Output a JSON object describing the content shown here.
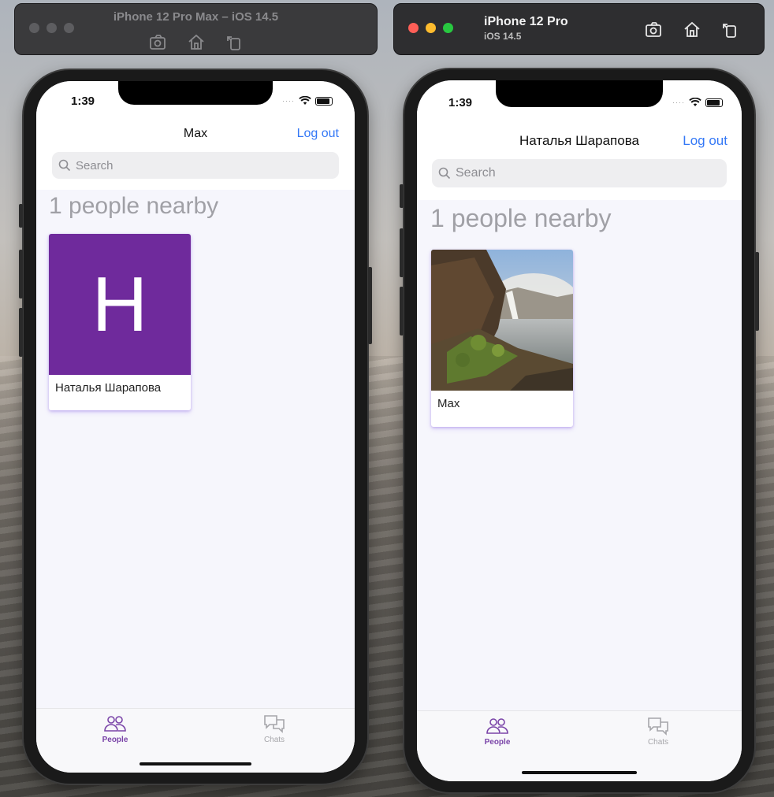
{
  "left_window": {
    "title": "iPhone 12 Pro Max – iOS 14.5",
    "icons": [
      "screenshot-icon",
      "home-icon",
      "rotate-icon"
    ]
  },
  "right_window": {
    "device_name": "iPhone 12 Pro",
    "os_version": "iOS 14.5",
    "icons": [
      "screenshot-icon",
      "home-icon",
      "rotate-icon"
    ]
  },
  "left_phone": {
    "status": {
      "time": "1:39"
    },
    "nav": {
      "title": "Max",
      "logout_label": "Log out"
    },
    "search": {
      "placeholder": "Search"
    },
    "heading": "1 people nearby",
    "people": [
      {
        "name": "Наталья Шарапова",
        "initial": "H",
        "avatar_color": "#6f2a9c"
      }
    ],
    "tabs": [
      {
        "label": "People",
        "active": true
      },
      {
        "label": "Chats",
        "active": false
      }
    ]
  },
  "right_phone": {
    "status": {
      "time": "1:39"
    },
    "nav": {
      "title": "Наталья Шарапова",
      "logout_label": "Log out"
    },
    "search": {
      "placeholder": "Search"
    },
    "heading": "1 people nearby",
    "people": [
      {
        "name": "Max",
        "photo": "waterfall-photo"
      }
    ],
    "tabs": [
      {
        "label": "People",
        "active": true
      },
      {
        "label": "Chats",
        "active": false
      }
    ]
  },
  "colors": {
    "accent": "#3478f6",
    "tab_active": "#7a44a8",
    "avatar": "#6f2a9c"
  }
}
